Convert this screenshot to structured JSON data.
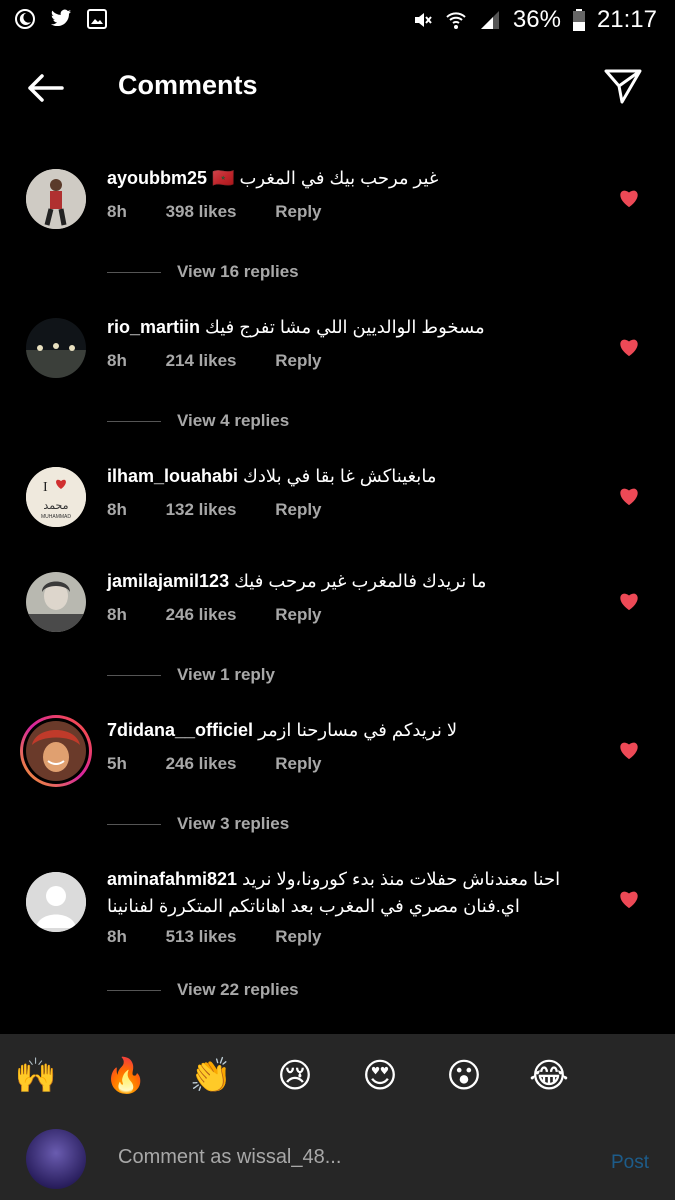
{
  "status_bar": {
    "battery": "36%",
    "time": "21:17",
    "icons": [
      "moon-icon",
      "twitter-icon",
      "gallery-icon",
      "mute-icon",
      "wifi-icon",
      "signal-icon",
      "battery-icon"
    ]
  },
  "header": {
    "title": "Comments",
    "back_icon": "arrow-left-icon",
    "send_icon": "paper-plane-icon"
  },
  "comments": [
    {
      "username": "ayoubbm25",
      "text": "غير مرحب بيك في المغرب 🇲🇦",
      "age": "8h",
      "likes": "398 likes",
      "reply": "Reply",
      "replies": "View 16 replies"
    },
    {
      "username": "rio_martiin",
      "text": "مسخوط الوالديين اللي مشا تفرج فيك",
      "age": "8h",
      "likes": "214 likes",
      "reply": "Reply",
      "replies": "View 4 replies"
    },
    {
      "username": "ilham_louahabi",
      "text": "مابغيناكش غا بقا في بلادك",
      "age": "8h",
      "likes": "132 likes",
      "reply": "Reply"
    },
    {
      "username": "jamilajamil123",
      "text": "ما نريدك فالمغرب غير مرحب فيك",
      "age": "8h",
      "likes": "246 likes",
      "reply": "Reply",
      "replies": "View 1 reply"
    },
    {
      "username": "7didana__officiel",
      "text": "لا نريدكم في مسارحنا ازمر",
      "age": "5h",
      "likes": "246 likes",
      "reply": "Reply",
      "replies": "View 3 replies"
    },
    {
      "username": "aminafahmi821",
      "text": "احنا معندناش حفلات منذ بدء كورونا،ولا نريد اي.فنان مصري في المغرب بعد اهاناتكم المتكررة لفنانينا",
      "age": "8h",
      "likes": "513 likes",
      "reply": "Reply",
      "replies": "View 22 replies"
    }
  ],
  "avatar_1_logo": {
    "line1": "I",
    "line2": "محمد",
    "line3": "MUHAMMAD"
  },
  "emoji_bar": {
    "emojis": [
      "🙌",
      "🔥",
      "👏",
      "😢",
      "😍",
      "😮",
      "😂"
    ]
  },
  "composer": {
    "placeholder": "Comment as wissal_48...",
    "post_label": "Post"
  },
  "colors": {
    "heart": "#ed4956",
    "background": "#000000",
    "meta": "#a8a8a8",
    "post": "#1d5c8a"
  }
}
